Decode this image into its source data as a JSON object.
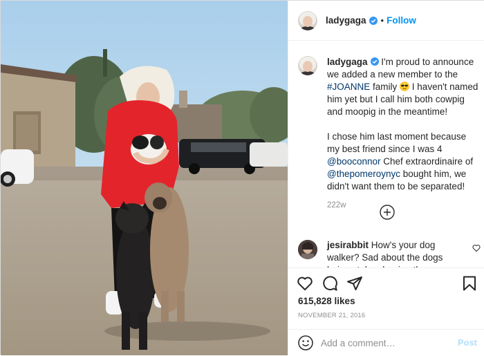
{
  "header": {
    "username": "ladygaga",
    "verified_icon": "verified-badge-icon",
    "separator": "•",
    "follow_label": "Follow"
  },
  "photo": {
    "icon": "post-photo",
    "colors": {
      "sky": "#b9d8ee",
      "shirt": "#e3242b",
      "ground": "#b8ab98"
    }
  },
  "caption": {
    "username": "ladygaga",
    "text_1": " I'm proud to announce we added a new member to the ",
    "hashtag": "#JOANNE",
    "text_2": " family ",
    "text_3": " I haven't named him yet but I call him both cowpig and moopig in the meantime!",
    "text_4": "I chose him last moment because my best friend since I was 4 ",
    "mention_1": "@booconnor",
    "text_5": " Chef extraordinaire of ",
    "mention_2": "@thepomeroynyc",
    "text_6": " bought him, we didn't want them to be separated!",
    "time": "222w"
  },
  "load_more": {
    "icon": "plus-circle-icon"
  },
  "comment": {
    "username": "jesirabbit",
    "text": " How's your dog walker? Sad about the dogs being stolen, hoping they are safe"
  },
  "actions": {
    "likes": "615,828 likes",
    "date": "NOVEMBER 21, 2016"
  },
  "add_comment": {
    "placeholder": "Add a comment…",
    "post_label": "Post"
  },
  "colors": {
    "link": "#00376b",
    "accent": "#0095f6",
    "muted": "#8e8e8e"
  }
}
